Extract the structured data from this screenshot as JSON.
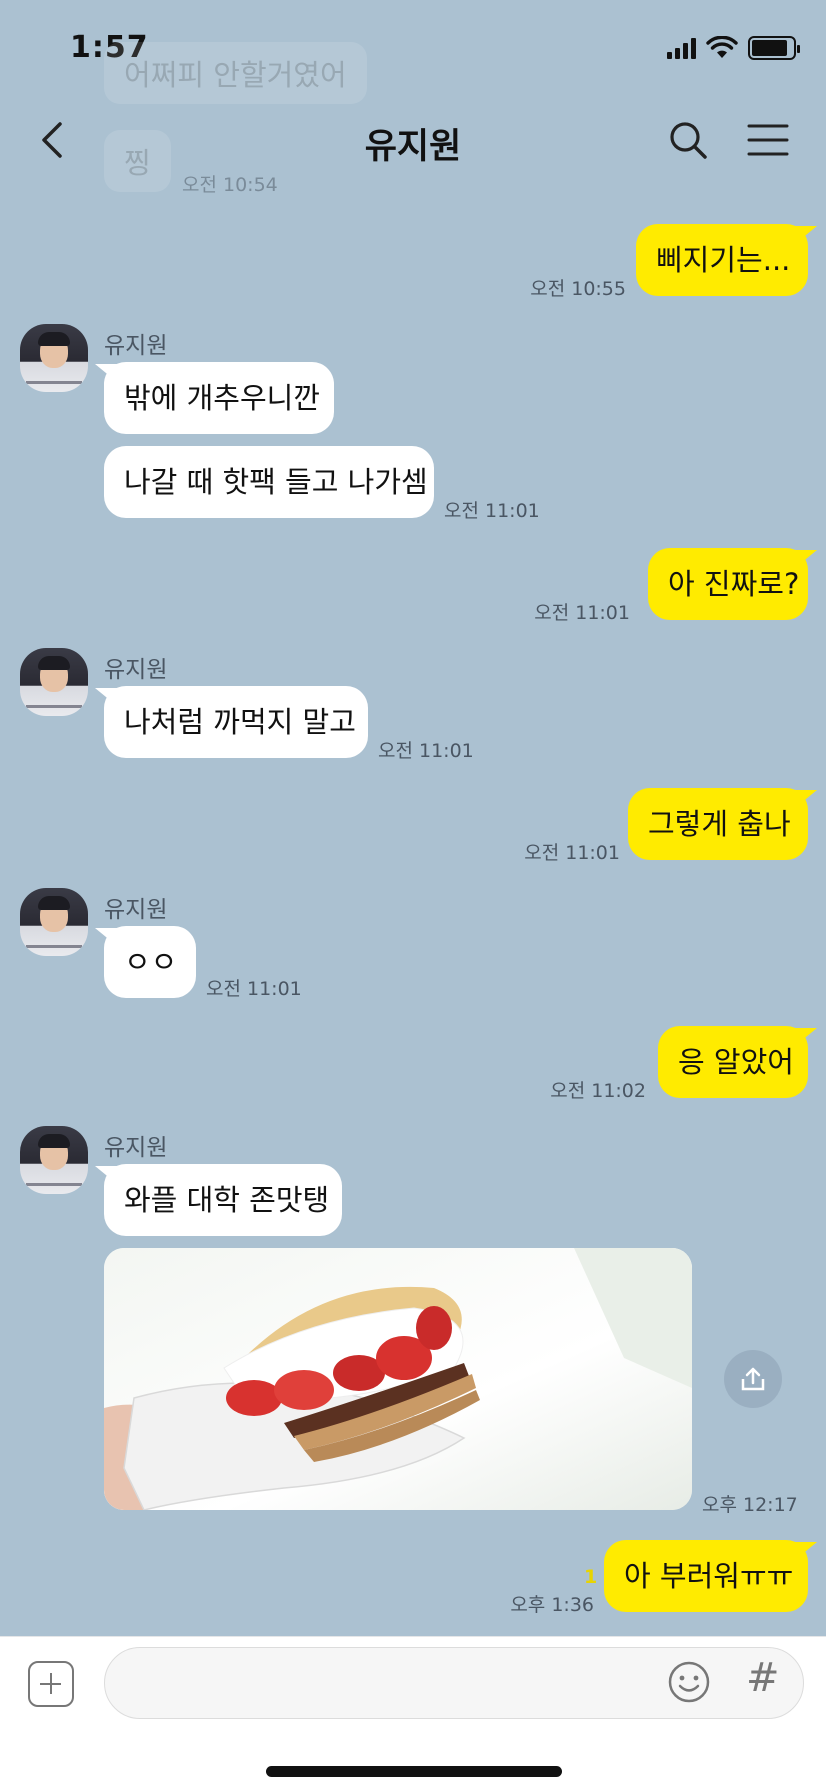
{
  "status_bar": {
    "time": "1:57"
  },
  "header": {
    "title": "유지원",
    "back_icon": "chevron-left-icon",
    "search_icon": "search-icon",
    "menu_icon": "hamburger-menu-icon"
  },
  "faded_messages": [
    {
      "text": "어쩌피 안할거였어"
    },
    {
      "text": "찡"
    },
    {
      "time": "오전 10:54"
    }
  ],
  "sender_name": "유지원",
  "messages": [
    {
      "direction": "out",
      "text": "삐지기는...",
      "time": "오전 10:55"
    },
    {
      "direction": "in",
      "text": "밖에 개추우니깐"
    },
    {
      "direction": "in",
      "text": "나갈 때 핫팩 들고 나가셈",
      "time": "오전 11:01"
    },
    {
      "direction": "out",
      "text": "아 진짜로?",
      "time": "오전 11:01"
    },
    {
      "direction": "in",
      "text": "나처럼 까먹지 말고",
      "time": "오전 11:01"
    },
    {
      "direction": "out",
      "text": "그렇게 춥나",
      "time": "오전 11:01"
    },
    {
      "direction": "in",
      "text": "ㅇㅇ",
      "time": "오전 11:01"
    },
    {
      "direction": "out",
      "text": "응 알았어",
      "time": "오전 11:02"
    },
    {
      "direction": "in",
      "text": "와플 대학 존맛탱"
    },
    {
      "direction": "in",
      "type": "photo",
      "time": "오후 12:17"
    },
    {
      "direction": "out",
      "text": "아 부러워ㅠㅠ",
      "time": "오후 1:36",
      "unread": "1"
    }
  ],
  "input": {
    "placeholder": "",
    "plus_icon": "plus-square-icon",
    "emoji_icon": "emoji-icon",
    "hash_label": "#"
  },
  "colors": {
    "background": "#abc1d1",
    "outgoing_bubble": "#ffeb00",
    "incoming_bubble": "#ffffff",
    "unread": "#e8d400"
  }
}
